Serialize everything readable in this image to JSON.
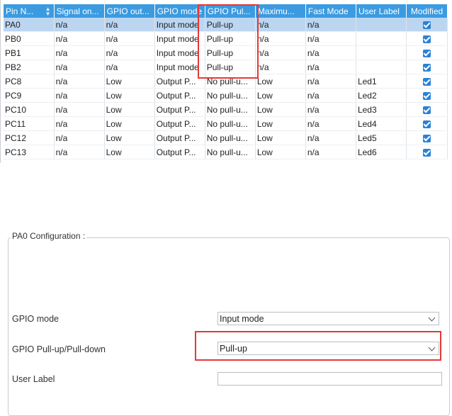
{
  "table": {
    "columns": [
      "Pin N...",
      "Signal on...",
      "GPIO out...",
      "GPIO mode",
      "GPIO Pul...",
      "Maximu...",
      "Fast Mode",
      "User Label",
      "Modified"
    ],
    "rows": [
      {
        "pin": "PA0",
        "signal": "n/a",
        "output": "n/a",
        "mode": "Input mode",
        "pull": "Pull-up",
        "max": "n/a",
        "fast": "n/a",
        "label": "",
        "modified": true
      },
      {
        "pin": "PB0",
        "signal": "n/a",
        "output": "n/a",
        "mode": "Input mode",
        "pull": "Pull-up",
        "max": "n/a",
        "fast": "n/a",
        "label": "",
        "modified": true
      },
      {
        "pin": "PB1",
        "signal": "n/a",
        "output": "n/a",
        "mode": "Input mode",
        "pull": "Pull-up",
        "max": "n/a",
        "fast": "n/a",
        "label": "",
        "modified": true
      },
      {
        "pin": "PB2",
        "signal": "n/a",
        "output": "n/a",
        "mode": "Input mode",
        "pull": "Pull-up",
        "max": "n/a",
        "fast": "n/a",
        "label": "",
        "modified": true
      },
      {
        "pin": "PC8",
        "signal": "n/a",
        "output": "Low",
        "mode": "Output P...",
        "pull": "No pull-u...",
        "max": "Low",
        "fast": "n/a",
        "label": "Led1",
        "modified": true
      },
      {
        "pin": "PC9",
        "signal": "n/a",
        "output": "Low",
        "mode": "Output P...",
        "pull": "No pull-u...",
        "max": "Low",
        "fast": "n/a",
        "label": "Led2",
        "modified": true
      },
      {
        "pin": "PC10",
        "signal": "n/a",
        "output": "Low",
        "mode": "Output P...",
        "pull": "No pull-u...",
        "max": "Low",
        "fast": "n/a",
        "label": "Led3",
        "modified": true
      },
      {
        "pin": "PC11",
        "signal": "n/a",
        "output": "Low",
        "mode": "Output P...",
        "pull": "No pull-u...",
        "max": "Low",
        "fast": "n/a",
        "label": "Led4",
        "modified": true
      },
      {
        "pin": "PC12",
        "signal": "n/a",
        "output": "Low",
        "mode": "Output P...",
        "pull": "No pull-u...",
        "max": "Low",
        "fast": "n/a",
        "label": "Led5",
        "modified": true
      },
      {
        "pin": "PC13",
        "signal": "n/a",
        "output": "Low",
        "mode": "Output P...",
        "pull": "No pull-u...",
        "max": "Low",
        "fast": "n/a",
        "label": "Led6",
        "modified": true
      }
    ]
  },
  "config": {
    "title": "PA0 Configuration :",
    "gpio_mode_label": "GPIO mode",
    "gpio_mode_value": "Input mode",
    "gpio_pull_label": "GPIO Pull-up/Pull-down",
    "gpio_pull_value": "Pull-up",
    "user_label_label": "User Label",
    "user_label_value": ""
  },
  "colors": {
    "header_bg": "#3c9be0",
    "selected_row": "#bcd6f2",
    "checkbox": "#2a82d6",
    "highlight": "#e53935"
  }
}
